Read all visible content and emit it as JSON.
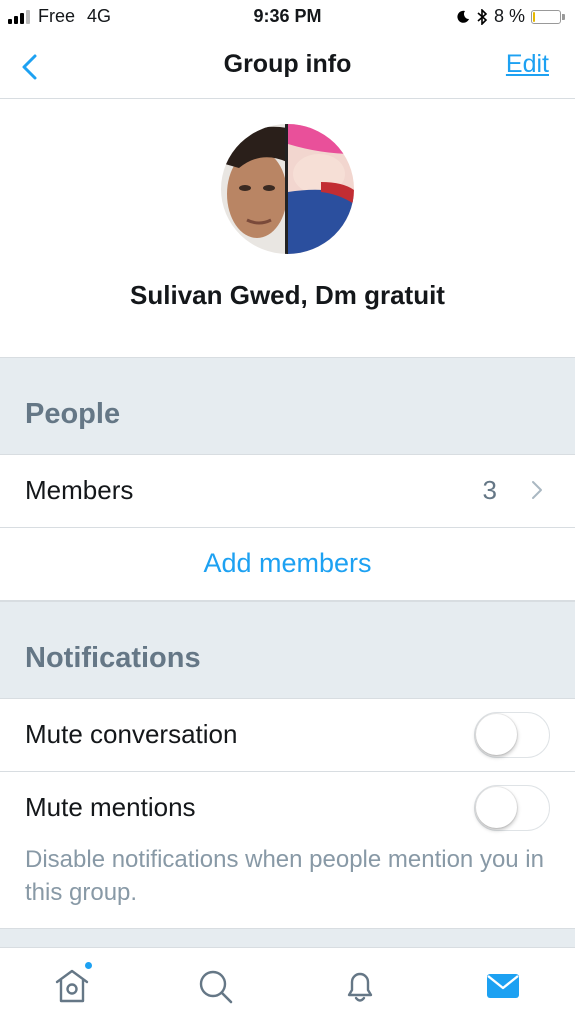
{
  "status_bar": {
    "carrier": "Free",
    "network": "4G",
    "time": "9:36 PM",
    "battery_text": "8 %",
    "battery_level": 0.08
  },
  "nav": {
    "title": "Group info",
    "edit_label": "Edit"
  },
  "group": {
    "name": "Sulivan Gwed, Dm gratuit"
  },
  "people": {
    "header": "People",
    "members_label": "Members",
    "members_count": "3",
    "add_members_label": "Add members"
  },
  "notifications": {
    "header": "Notifications",
    "mute_conversation_label": "Mute conversation",
    "mute_conversation_on": false,
    "mute_mentions_label": "Mute mentions",
    "mute_mentions_on": false,
    "mute_mentions_helper": "Disable notifications when people mention you in this group."
  },
  "tabbar": {
    "icons": [
      "home-icon",
      "search-icon",
      "bell-icon",
      "mail-icon"
    ],
    "active": "mail-icon",
    "home_has_badge": true
  },
  "colors": {
    "accent": "#1da1f2",
    "section_bg": "#e6ecf0",
    "section_text": "#657786",
    "helper_text": "#8899a6"
  }
}
